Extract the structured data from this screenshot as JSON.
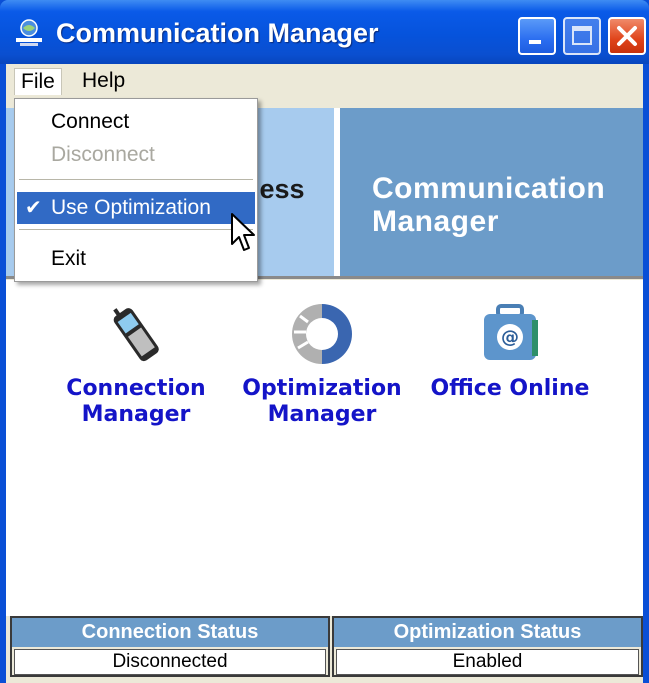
{
  "window": {
    "title": "Communication Manager",
    "controls": [
      "minimize",
      "maximize",
      "close"
    ]
  },
  "menubar": {
    "items": [
      "File",
      "Help"
    ]
  },
  "file_menu": {
    "items": [
      {
        "label": "Connect",
        "enabled": true,
        "checked": false
      },
      {
        "label": "Disconnect",
        "enabled": false,
        "checked": false
      },
      {
        "label": "Use Optimization",
        "enabled": true,
        "checked": true,
        "highlighted": true
      },
      {
        "label": "Exit",
        "enabled": true,
        "checked": false
      }
    ]
  },
  "banner": {
    "left_partial_text": "less",
    "title": "Communication Manager"
  },
  "launchers": [
    {
      "label": "Connection Manager",
      "icon": "mobile-phone-icon"
    },
    {
      "label": "Optimization Manager",
      "icon": "optimization-icon"
    },
    {
      "label": "Office Online",
      "icon": "office-online-icon"
    }
  ],
  "status": {
    "connection_header": "Connection Status",
    "connection_value": "Disconnected",
    "optimization_header": "Optimization Status",
    "optimization_value": "Enabled"
  },
  "colors": {
    "title_bar": "#0a5ae8",
    "banner_light": "#a7cbee",
    "banner_dark": "#6c9cc9",
    "launcher_text": "#1414c8",
    "menu_highlight": "#316ac5"
  }
}
